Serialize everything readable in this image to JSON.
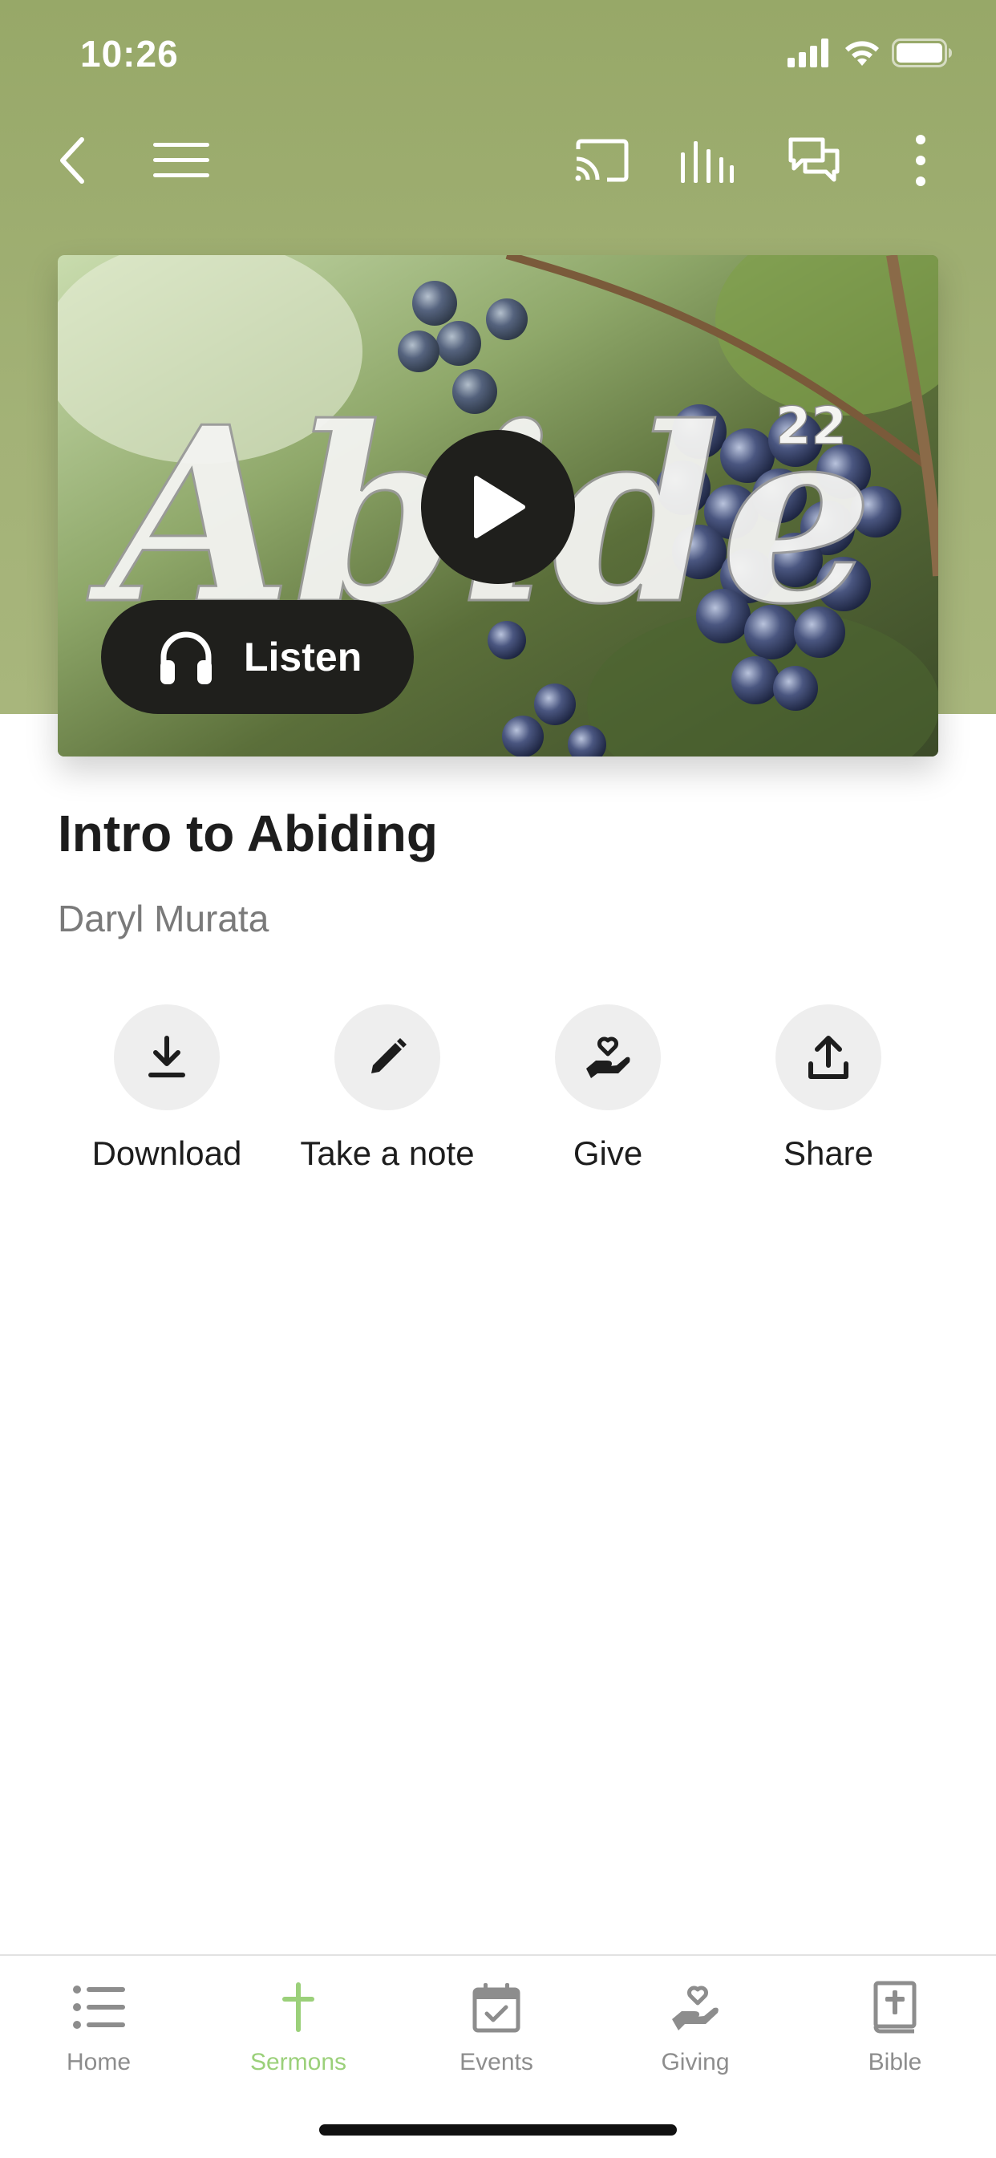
{
  "status_bar": {
    "time": "10:26"
  },
  "header": {
    "accent_color": "#a3b277"
  },
  "hero": {
    "artwork_text": "Abide",
    "artwork_badge": "22",
    "listen_label": "Listen"
  },
  "sermon": {
    "title": "Intro to Abiding",
    "speaker": "Daryl Murata"
  },
  "actions": [
    {
      "label": "Download",
      "icon": "download-icon"
    },
    {
      "label": "Take a note",
      "icon": "pencil-icon"
    },
    {
      "label": "Give",
      "icon": "give-hand-heart-icon"
    },
    {
      "label": "Share",
      "icon": "share-icon"
    }
  ],
  "tabbar": {
    "active_color": "#9bd07a",
    "inactive_color": "#8d8d8d",
    "tabs": [
      {
        "label": "Home",
        "icon": "list-icon",
        "active": false
      },
      {
        "label": "Sermons",
        "icon": "cross-icon",
        "active": true
      },
      {
        "label": "Events",
        "icon": "calendar-icon",
        "active": false
      },
      {
        "label": "Giving",
        "icon": "hand-heart-icon",
        "active": false
      },
      {
        "label": "Bible",
        "icon": "bible-icon",
        "active": false
      }
    ]
  }
}
